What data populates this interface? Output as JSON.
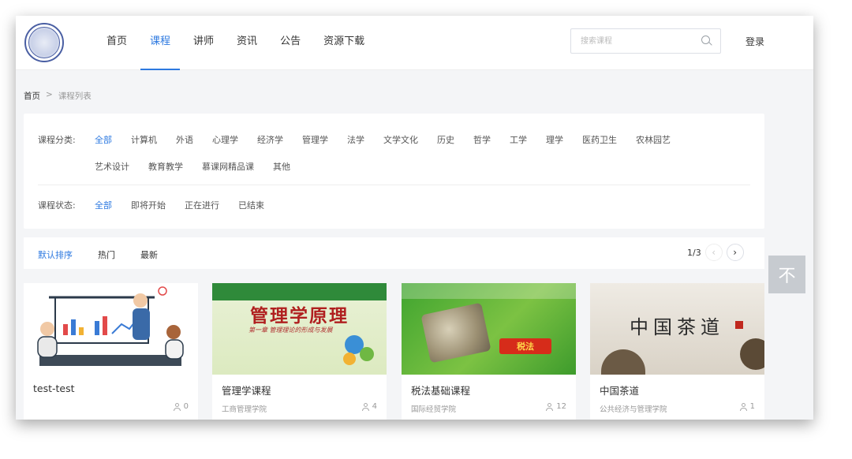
{
  "header": {
    "nav": [
      "首页",
      "课程",
      "讲师",
      "资讯",
      "公告",
      "资源下载"
    ],
    "active_nav": 1,
    "search": {
      "placeholder": "搜索课程",
      "icon": "search-icon"
    },
    "login_label": "登录"
  },
  "breadcrumb": {
    "home": "首页",
    "separator": ">",
    "current": "课程列表"
  },
  "filters": {
    "category": {
      "label": "课程分类:",
      "items": [
        "全部",
        "计算机",
        "外语",
        "心理学",
        "经济学",
        "管理学",
        "法学",
        "文学文化",
        "历史",
        "哲学",
        "工学",
        "理学",
        "医药卫生",
        "农林园艺",
        "艺术设计",
        "教育教学",
        "慕课网精品课",
        "其他"
      ],
      "active": 0
    },
    "status": {
      "label": "课程状态:",
      "items": [
        "全部",
        "即将开始",
        "正在进行",
        "已结束"
      ],
      "active": 0
    }
  },
  "sort": {
    "options": [
      "默认排序",
      "热门",
      "最新"
    ],
    "active": 0,
    "page": "1/3"
  },
  "back_to_top": "不",
  "cards": [
    {
      "title": "test-test",
      "org": "",
      "count": "0"
    },
    {
      "title": "管理学课程",
      "org": "工商管理学院",
      "count": "4",
      "cover_title": "管理学原理",
      "cover_sub": "第一章 管理理论的形成与发展"
    },
    {
      "title": "税法基础课程",
      "org": "国际经贸学院",
      "count": "12",
      "cover_tag": "税法"
    },
    {
      "title": "中国茶道",
      "org": "公共经济与管理学院",
      "count": "1",
      "cover_title": "中国茶道"
    }
  ],
  "colors": {
    "accent": "#2d79e0",
    "muted": "#999999"
  }
}
